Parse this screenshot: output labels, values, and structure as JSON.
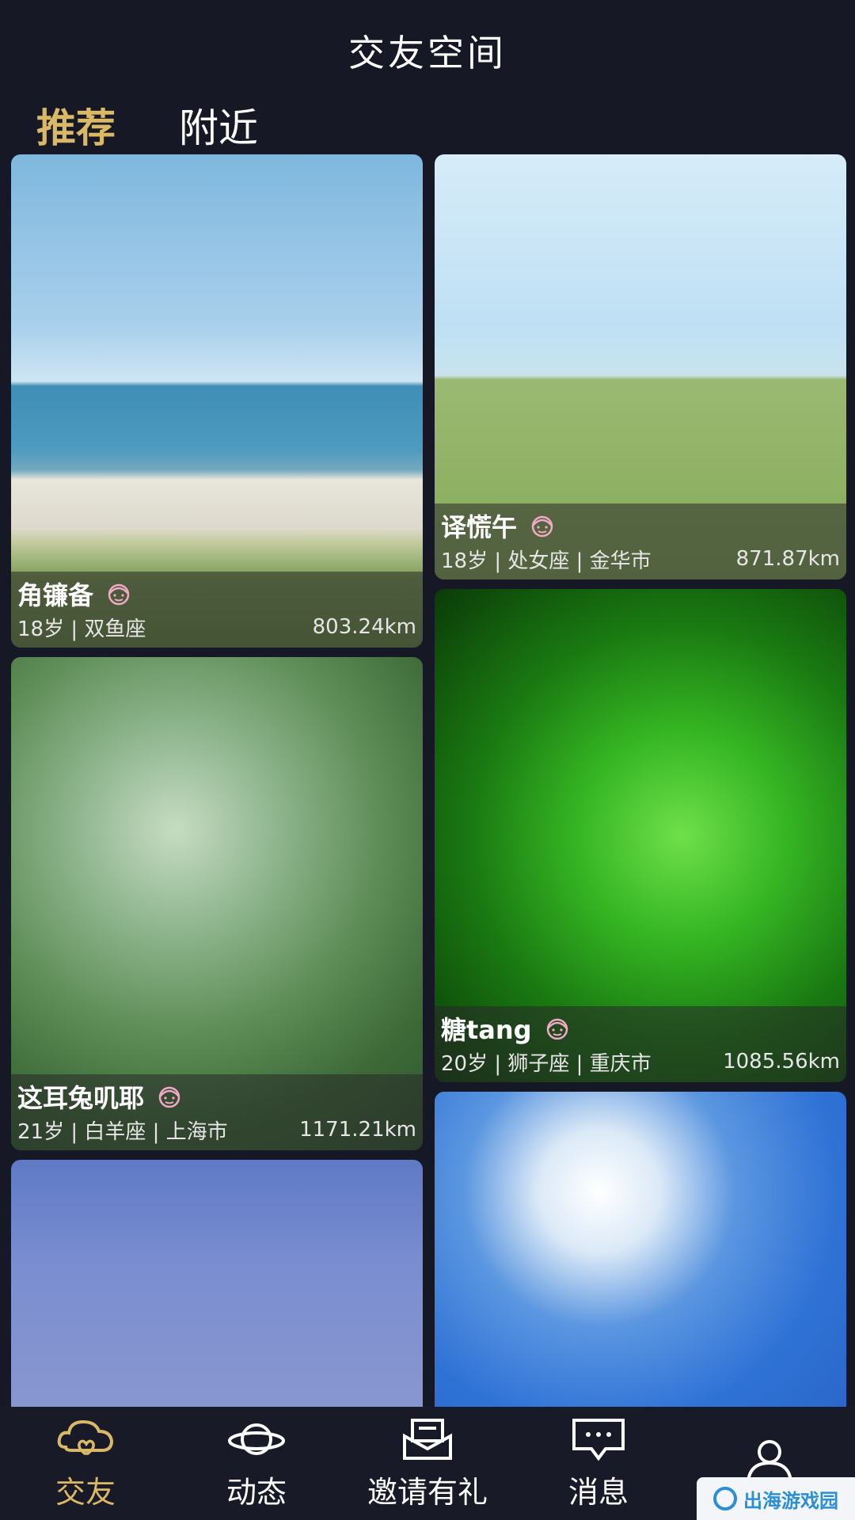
{
  "header": {
    "title": "交友空间"
  },
  "tabs": [
    {
      "label": "推荐",
      "active": true
    },
    {
      "label": "附近",
      "active": false
    }
  ],
  "cards": [
    {
      "name": "角镰备",
      "info": "18岁 | 双鱼座",
      "distance": "803.24km"
    },
    {
      "name": "译慌午",
      "info": "18岁 | 处女座 | 金华市",
      "distance": "871.87km"
    },
    {
      "name": "这耳兔叽耶",
      "info": "21岁 | 白羊座 | 上海市",
      "distance": "1171.21km"
    },
    {
      "name": "糖tang",
      "info": "20岁 | 狮子座 | 重庆市",
      "distance": "1085.56km"
    }
  ],
  "nav": [
    {
      "label": "交友",
      "icon": "heart-cloud-icon",
      "active": true
    },
    {
      "label": "动态",
      "icon": "planet-icon",
      "active": false
    },
    {
      "label": "邀请有礼",
      "icon": "envelope-icon",
      "active": false
    },
    {
      "label": "消息",
      "icon": "chat-icon",
      "active": false
    },
    {
      "label": "",
      "icon": "user-icon",
      "active": false
    }
  ],
  "watermark": {
    "text": "出海游戏园"
  },
  "colors": {
    "accent": "#d9b866",
    "background": "#161826"
  }
}
